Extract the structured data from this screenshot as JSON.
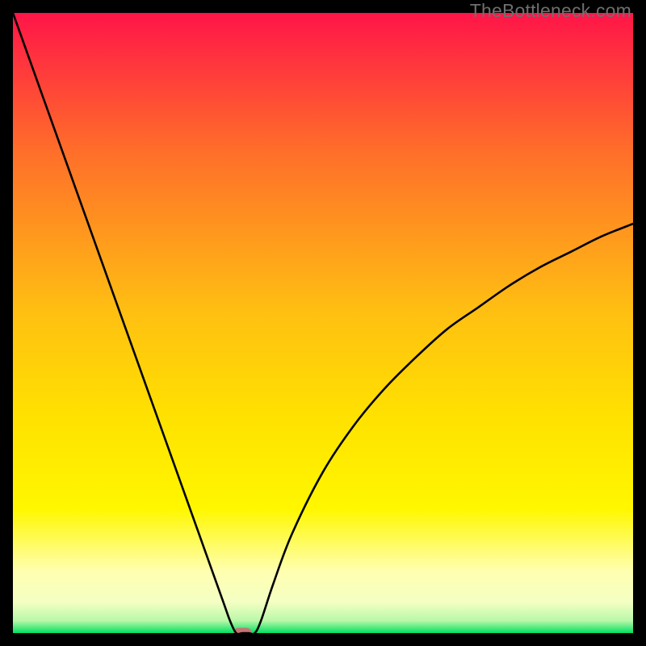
{
  "watermark": "TheBottleneck.com",
  "chart_data": {
    "type": "line",
    "title": "",
    "xlabel": "",
    "ylabel": "",
    "xlim": [
      0,
      100
    ],
    "ylim": [
      0,
      100
    ],
    "grid": false,
    "axes_visible": false,
    "background_gradient": {
      "top_color": "#ff1548",
      "middle_color": "#ffd500",
      "lower_color": "#ffff80",
      "bottom_color": "#00e060"
    },
    "series": [
      {
        "name": "bottleneck-curve",
        "color": "#000000",
        "x": [
          0,
          5,
          10,
          15,
          20,
          25,
          28,
          30,
          32,
          34,
          35,
          36,
          37,
          38,
          39,
          40,
          42,
          45,
          50,
          55,
          60,
          65,
          70,
          75,
          80,
          85,
          90,
          95,
          100
        ],
        "y": [
          100,
          86,
          72,
          58,
          44,
          30,
          21.6,
          16,
          10.4,
          4.8,
          2,
          0,
          0,
          0,
          0,
          2,
          8,
          16,
          26,
          33.5,
          39.5,
          44.5,
          49,
          52.5,
          56,
          59,
          61.5,
          64,
          66
        ]
      }
    ],
    "annotations": [
      {
        "name": "minimum-marker",
        "shape": "rounded-rect",
        "color": "#c77373",
        "cx": 37,
        "cy": 0,
        "w": 3,
        "h": 1.7
      }
    ]
  }
}
